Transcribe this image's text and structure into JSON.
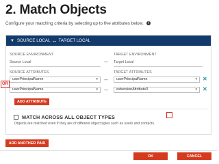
{
  "page": {
    "title": "2. Match Objects",
    "subtitle": "Configure your matching criteria by selecting up to five attributes below.",
    "info_icon": "i"
  },
  "pair": {
    "header": {
      "source": "SOURCE LOCAL",
      "arrow": "↔",
      "target": "TARGET LOCAL"
    },
    "source_env_label": "SOURCE ENVIRONMENT",
    "source_env_value": "Source Local",
    "target_env_label": "TARGET ENVIRONMENT",
    "target_env_value": "Target Local",
    "source_attr_label": "SOURCE ATTRIBUTES",
    "target_attr_label": "TARGET ATTRIBUTES",
    "rows": [
      {
        "source": "userPrincipalName",
        "target": "userPrincipalName"
      },
      {
        "source": "userPrincipalName",
        "target": "extensionAttribute3"
      }
    ],
    "or_label": "OR",
    "add_attribute": "ADD ATTRIBUTE",
    "match_all_label": "MATCH ACROSS ALL OBJECT TYPES",
    "match_all_desc": "Objects are matched even if they are of different object types such as users and contacts.",
    "match_all_checked": false
  },
  "add_pair": "ADD ANOTHER PAIR",
  "ok": "OK",
  "cancel": "CANCEL",
  "colors": {
    "header": "#123a6b",
    "button": "#d63a1e",
    "accent": "#2a9d9d",
    "highlight": "#d9302c"
  }
}
